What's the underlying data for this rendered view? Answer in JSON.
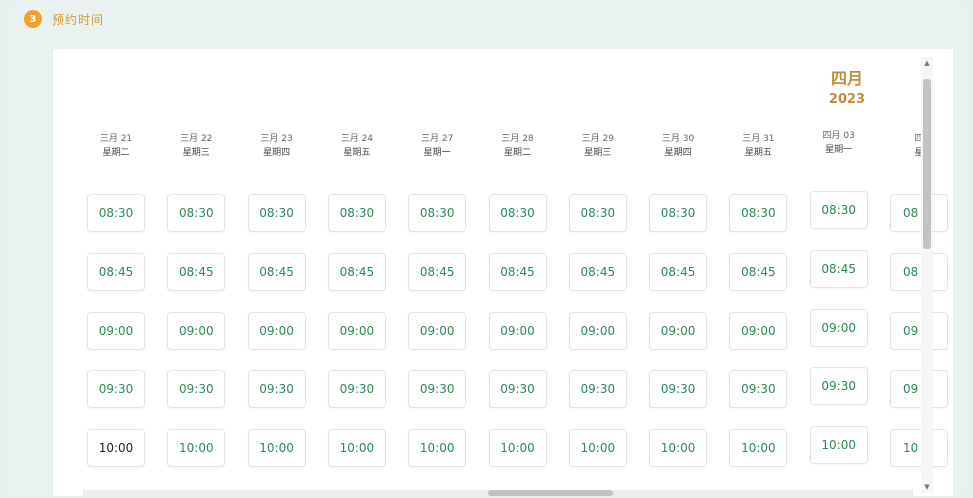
{
  "header": {
    "step_number": "3",
    "title": "预约时间"
  },
  "calendar": {
    "month_label": "四月",
    "year_label": "2023",
    "days": [
      {
        "date": "三月 21",
        "weekday": "星期二"
      },
      {
        "date": "三月 22",
        "weekday": "星期三"
      },
      {
        "date": "三月 23",
        "weekday": "星期四"
      },
      {
        "date": "三月 24",
        "weekday": "星期五"
      },
      {
        "date": "三月 27",
        "weekday": "星期一"
      },
      {
        "date": "三月 28",
        "weekday": "星期二"
      },
      {
        "date": "三月 29",
        "weekday": "星期三"
      },
      {
        "date": "三月 30",
        "weekday": "星期四"
      },
      {
        "date": "三月 31",
        "weekday": "星期五"
      },
      {
        "date": "四月 03",
        "weekday": "星期一"
      },
      {
        "date": "四",
        "weekday": "星"
      }
    ],
    "time_slots": [
      "08:30",
      "08:45",
      "09:00",
      "09:30",
      "10:00"
    ],
    "partial_slots": [
      "08",
      "08",
      "09",
      "09",
      "10"
    ]
  },
  "colors": {
    "accent": "#c98a3a",
    "slot_text": "#2e8a55",
    "step_dot": "#f0a32a"
  }
}
